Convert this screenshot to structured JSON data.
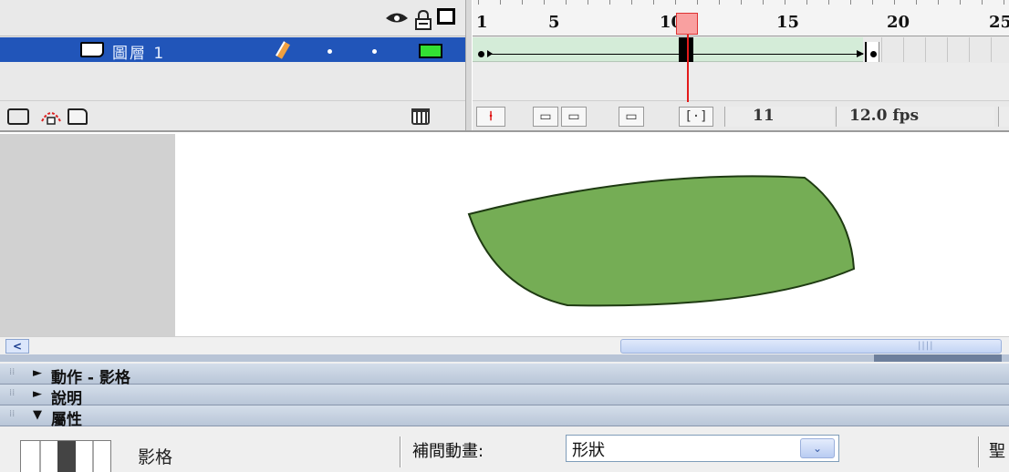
{
  "timeline": {
    "header_icons": [
      "eye-icon",
      "lock-icon",
      "outline-icon"
    ],
    "layer": {
      "name": "圖層 1",
      "outline_color": "#33e033"
    },
    "ruler_numbers": [
      "1",
      "5",
      "10",
      "15",
      "20",
      "25"
    ],
    "current_frame": "11",
    "frame_rate": "12.0 fps",
    "tween_color": "#d4ecd8",
    "playhead_color": "#e31b1b"
  },
  "stage": {
    "shape_fill": "#75ad55",
    "shape_stroke": "#1e3a12",
    "pasteboard_color": "#d1d1d1"
  },
  "panels": {
    "actions_title": "動作 - 影格",
    "help_title": "說明",
    "properties_title": "屬性",
    "properties": {
      "frame_label": "影格",
      "tween_label": "補間動畫:",
      "tween_value": "形狀",
      "blend_label": "聖"
    }
  }
}
